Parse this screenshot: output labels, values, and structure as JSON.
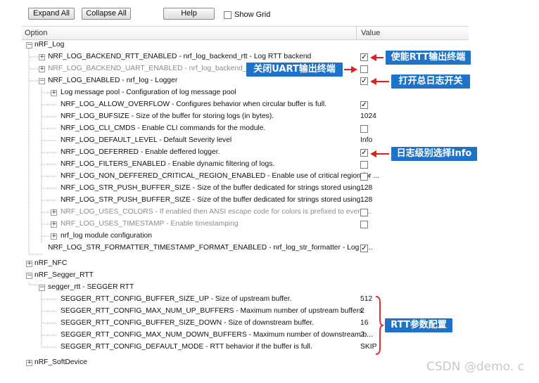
{
  "toolbar": {
    "expand_all": "Expand All",
    "collapse_all": "Collapse All",
    "help": "Help",
    "show_grid": "Show Grid"
  },
  "header": {
    "option": "Option",
    "value": "Value"
  },
  "tree": [
    {
      "label": "nRF_Log",
      "toggle": "−"
    },
    {
      "label": "NRF_LOG_BACKEND_RTT_ENABLED - nrf_log_backend_rtt - Log RTT backend",
      "toggle": "+",
      "checked": true
    },
    {
      "label": "NRF_LOG_BACKEND_UART_ENABLED - nrf_log_backend_uart",
      "toggle": "+",
      "checked": false
    },
    {
      "label": "NRF_LOG_ENABLED - nrf_log - Logger",
      "toggle": "−",
      "checked": true
    },
    {
      "label": "Log message pool - Configuration of log message pool",
      "toggle": "+"
    },
    {
      "label": "NRF_LOG_ALLOW_OVERFLOW  - Configures behavior when circular buffer is full.",
      "checked": true
    },
    {
      "label": "NRF_LOG_BUFSIZE - Size of the buffer for storing logs (in bytes).",
      "value": "1024"
    },
    {
      "label": "NRF_LOG_CLI_CMDS - Enable CLI commands for the module.",
      "checked": false
    },
    {
      "label": "NRF_LOG_DEFAULT_LEVEL - Default Severity level",
      "value": "Info"
    },
    {
      "label": "NRF_LOG_DEFERRED - Enable deffered logger.",
      "checked": true
    },
    {
      "label": "NRF_LOG_FILTERS_ENABLED - Enable dynamic filtering of logs.",
      "checked": false
    },
    {
      "label": "NRF_LOG_NON_DEFFERED_CRITICAL_REGION_ENABLED - Enable use of critical region for ...",
      "checked": false
    },
    {
      "label": "NRF_LOG_STR_PUSH_BUFFER_SIZE - Size of the buffer dedicated for strings stored using ...",
      "value": "128"
    },
    {
      "label": "NRF_LOG_STR_PUSH_BUFFER_SIZE - Size of the buffer dedicated for strings stored using ...",
      "value": "128"
    },
    {
      "label": "NRF_LOG_USES_COLORS - If enabled then ANSI escape code for colors is prefixed to every ...",
      "toggle": "+",
      "checked": false
    },
    {
      "label": "NRF_LOG_USES_TIMESTAMP - Enable timestamping",
      "toggle": "+",
      "checked": false
    },
    {
      "label": "nrf_log module configuration",
      "toggle": "+"
    },
    {
      "label": "NRF_LOG_STR_FORMATTER_TIMESTAMP_FORMAT_ENABLED  - nrf_log_str_formatter - Log st...",
      "checked": true
    },
    {
      "label": "nRF_NFC",
      "toggle": "+"
    },
    {
      "label": "nRF_Segger_RTT",
      "toggle": "−"
    },
    {
      "label": "segger_rtt - SEGGER RTT",
      "toggle": "−"
    },
    {
      "label": "SEGGER_RTT_CONFIG_BUFFER_SIZE_UP - Size of upstream buffer.",
      "value": "512"
    },
    {
      "label": "SEGGER_RTT_CONFIG_MAX_NUM_UP_BUFFERS - Maximum number of upstream buffers.",
      "value": "2"
    },
    {
      "label": "SEGGER_RTT_CONFIG_BUFFER_SIZE_DOWN - Size of downstream buffer.",
      "value": "16"
    },
    {
      "label": "SEGGER_RTT_CONFIG_MAX_NUM_DOWN_BUFFERS - Maximum number of downstream b...",
      "value": "2"
    },
    {
      "label": "SEGGER_RTT_CONFIG_DEFAULT_MODE - RTT behavior if the buffer is full.",
      "value": "SKIP"
    },
    {
      "label": "nRF_SoftDevice",
      "toggle": "+"
    }
  ],
  "annotations": {
    "rtt_enable": "使能RTT输出终端",
    "uart_disable": "关闭UART输出终端",
    "log_enable": "打开总日志开关",
    "log_level": "日志级别选择Info",
    "rtt_params": "RTT参数配置"
  },
  "colors": {
    "annotation": "#1e73c8",
    "arrow": "#e02020",
    "bracket": "#e03030"
  },
  "watermark": "CSDN @demo. c"
}
